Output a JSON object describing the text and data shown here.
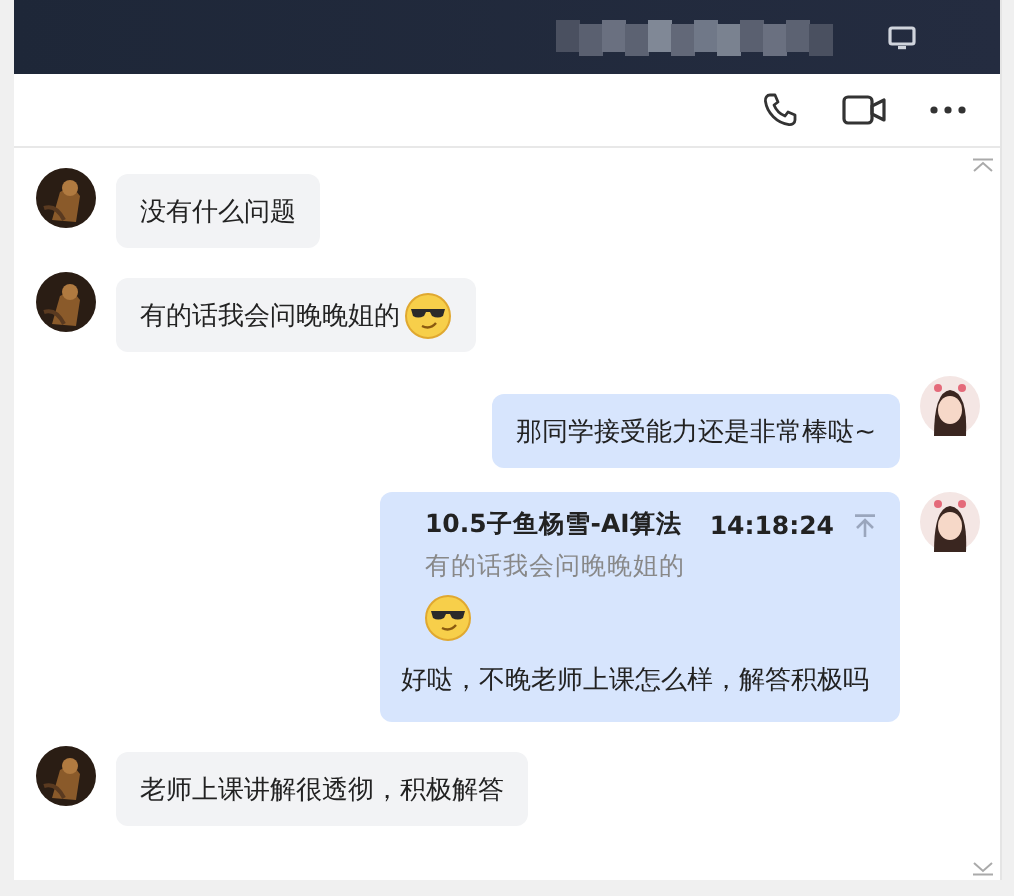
{
  "messages": [
    {
      "outgoing": false,
      "kind": "text",
      "text": "没有什么问题",
      "emoji": false
    },
    {
      "outgoing": false,
      "kind": "text",
      "text": "有的话我会问晚晚姐的",
      "emoji": true
    },
    {
      "outgoing": true,
      "kind": "text",
      "text": "那同学接受能力还是非常棒哒~",
      "emoji": false
    },
    {
      "outgoing": true,
      "kind": "quote",
      "author": "10.5子鱼杨雪-AI算法",
      "time": "14:18:24",
      "quoted_text": "有的话我会问晚晚姐的",
      "quoted_emoji": true,
      "text": "好哒，不晚老师上课怎么样，解答积极吗"
    },
    {
      "outgoing": false,
      "kind": "text",
      "text": "老师上课讲解很透彻，积极解答",
      "emoji": false
    }
  ]
}
